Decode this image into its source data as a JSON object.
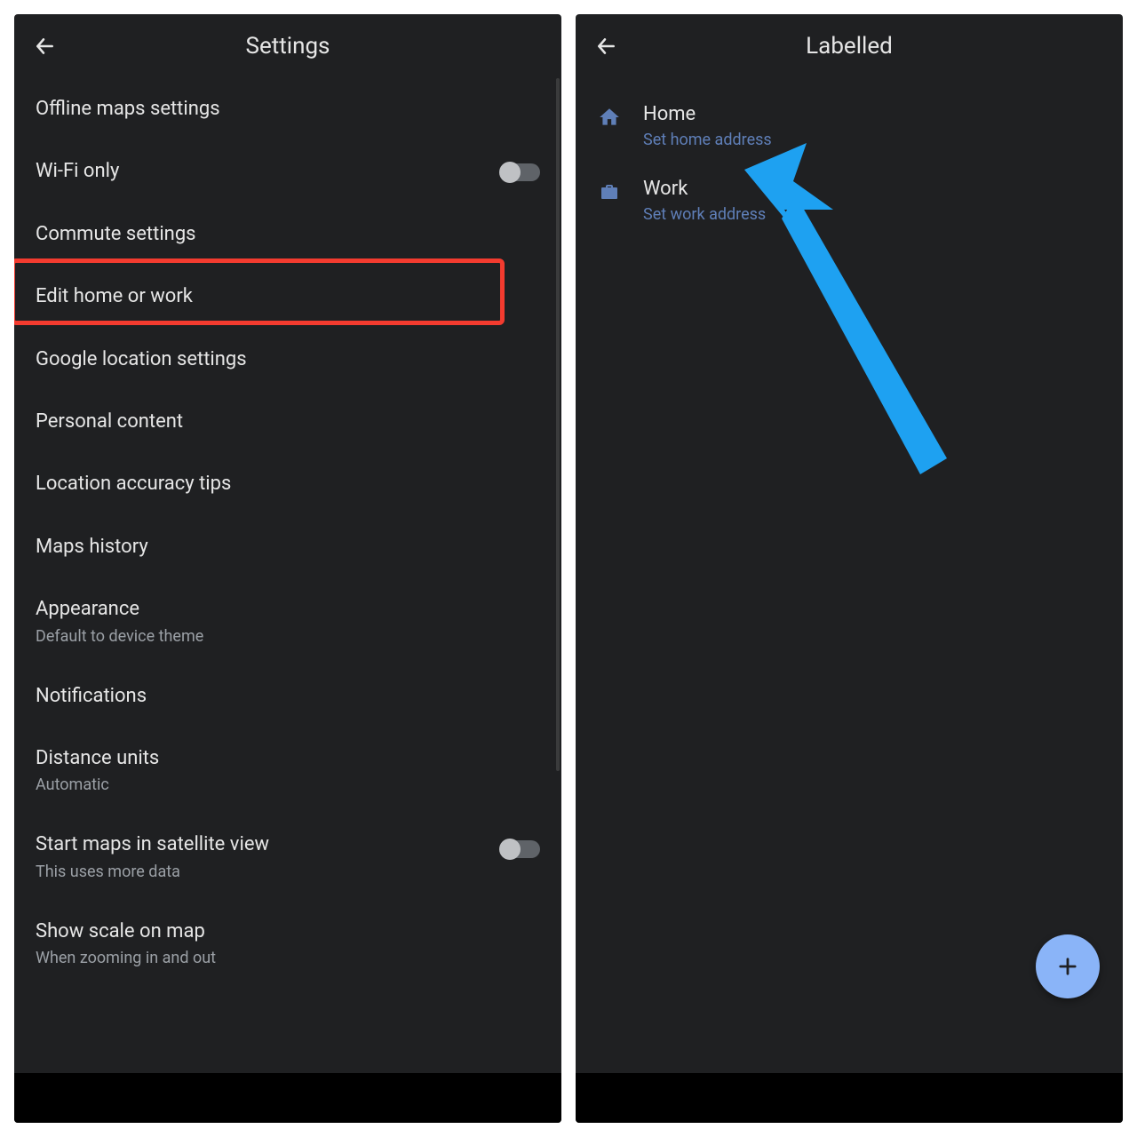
{
  "left": {
    "title": "Settings",
    "items": [
      {
        "label": "Offline maps settings"
      },
      {
        "label": "Wi-Fi only",
        "toggle": true,
        "on": false
      },
      {
        "label": "Commute settings"
      },
      {
        "label": "Edit home or work",
        "highlighted": true
      },
      {
        "label": "Google location settings"
      },
      {
        "label": "Personal content"
      },
      {
        "label": "Location accuracy tips"
      },
      {
        "label": "Maps history"
      },
      {
        "label": "Appearance",
        "sub": "Default to device theme"
      },
      {
        "label": "Notifications"
      },
      {
        "label": "Distance units",
        "sub": "Automatic"
      },
      {
        "label": "Start maps in satellite view",
        "sub": "This uses more data",
        "toggle": true,
        "on": false
      },
      {
        "label": "Show scale on map",
        "sub": "When zooming in and out"
      }
    ]
  },
  "right": {
    "title": "Labelled",
    "items": [
      {
        "icon": "home-icon",
        "title": "Home",
        "desc": "Set home address"
      },
      {
        "icon": "briefcase-icon",
        "title": "Work",
        "desc": "Set work address"
      }
    ]
  }
}
